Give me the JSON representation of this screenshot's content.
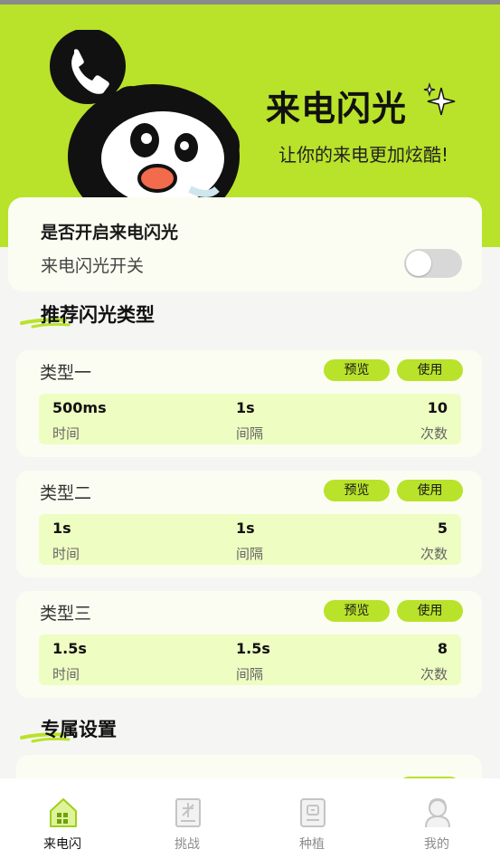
{
  "hero": {
    "title": "来电闪光",
    "subtitle": "让你的来电更加炫酷!"
  },
  "switch_card": {
    "title": "是否开启来电闪光",
    "label": "来电闪光开关",
    "enabled": false
  },
  "sections": {
    "recommended": "推荐闪光类型",
    "exclusive": "专属设置"
  },
  "types": [
    {
      "name": "类型一",
      "preview_label": "预览",
      "use_label": "使用",
      "duration": "500ms",
      "duration_label": "时间",
      "interval": "1s",
      "interval_label": "间隔",
      "count": "10",
      "count_label": "次数"
    },
    {
      "name": "类型二",
      "preview_label": "预览",
      "use_label": "使用",
      "duration": "1s",
      "duration_label": "时间",
      "interval": "1s",
      "interval_label": "间隔",
      "count": "5",
      "count_label": "次数"
    },
    {
      "name": "类型三",
      "preview_label": "预览",
      "use_label": "使用",
      "duration": "1.5s",
      "duration_label": "时间",
      "interval": "1.5s",
      "interval_label": "间隔",
      "count": "8",
      "count_label": "次数"
    }
  ],
  "tabbar": {
    "items": [
      {
        "label": "来电闪",
        "icon": "home-icon",
        "active": true
      },
      {
        "label": "挑战",
        "icon": "challenge-icon",
        "active": false
      },
      {
        "label": "种植",
        "icon": "plant-icon",
        "active": false
      },
      {
        "label": "我的",
        "icon": "profile-icon",
        "active": false
      }
    ]
  },
  "colors": {
    "accent": "#b9e22a",
    "stats_bg": "#eefdc1",
    "card_bg": "#fbfdf2"
  }
}
